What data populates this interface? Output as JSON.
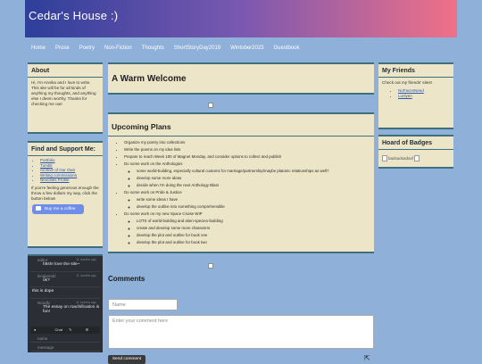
{
  "site": {
    "title": "Cedar's House :)"
  },
  "nav": [
    "Home",
    "Prose",
    "Poetry",
    "Non-Fiction",
    "Thoughts",
    "ShortStoryDay2019",
    "Wintober2023",
    "Guestbook"
  ],
  "about": {
    "heading": "About",
    "text": "Hi, I'm Annika and I love to write. This site will be for all kinds of anything my thoughts, and anything else I deem worthy. Thanks for checking me out!"
  },
  "support": {
    "heading": "Find and Support Me:",
    "links": [
      "Portfolio",
      "Tumblr",
      "Archive of Our Own",
      "Writing commissions",
      "Neocities Profile"
    ],
    "text": "If you're feeling generous enough the throw a few dollars my way, click the button below!",
    "coffee_label": "Buy me a coffee"
  },
  "chat": {
    "messages": [
      {
        "name": "editor",
        "time": "11 months ago",
        "text": "h8sh! love the site~"
      },
      {
        "name": "kingkendri",
        "time": "11 months ago",
        "text": "ok?"
      },
      {
        "name": "",
        "time": "",
        "text": "this is dope"
      },
      {
        "name": "Noodly",
        "time": "11 months ago",
        "text": "The essay on roachification is fun!"
      }
    ],
    "bar_label": "Chat",
    "name_placeholder": "name",
    "message_placeholder": "message"
  },
  "main": {
    "welcome_title": "A Warm Welcome",
    "plans_title": "Upcoming Plans",
    "plans": [
      {
        "text": "Organize my poetry into collections",
        "sub": []
      },
      {
        "text": "Write the poems on my idea lists",
        "sub": []
      },
      {
        "text": "Prepare to reach Week 100 of Magnet Monday, and consider options to collect and publish",
        "sub": []
      },
      {
        "text": "Do some work on the Anthologies",
        "sub": [
          "some world-building, especially cultural customs for marriage/partnership/maybe platonic relationships as well?",
          "develop some more ideas",
          "decide when I'm doing the next Anthology Blast"
        ]
      },
      {
        "text": "Do some work on Pride & Justice",
        "sub": [
          "write some ideas I have",
          "develop the outline into something comprehensible"
        ]
      },
      {
        "text": "Do some work on my new Space Cruise WIP",
        "sub": [
          "LOTS of world-building and alien-species-building",
          "create and develop some more characters",
          "develop the plot and outline for book one",
          "develop the plot and outline for book two"
        ]
      }
    ],
    "comments_title": "Comments",
    "name_placeholder": "Name",
    "comment_placeholder": "Enter your comment here",
    "send_label": "Send comment"
  },
  "friends": {
    "heading": "My Friends",
    "text": "Check out my friends' sites!",
    "links": [
      "NoFacesNeed",
      "Lunlyen"
    ]
  },
  "badges": {
    "heading": "Hoard of Badges",
    "alt": "badsadsadsaf"
  }
}
